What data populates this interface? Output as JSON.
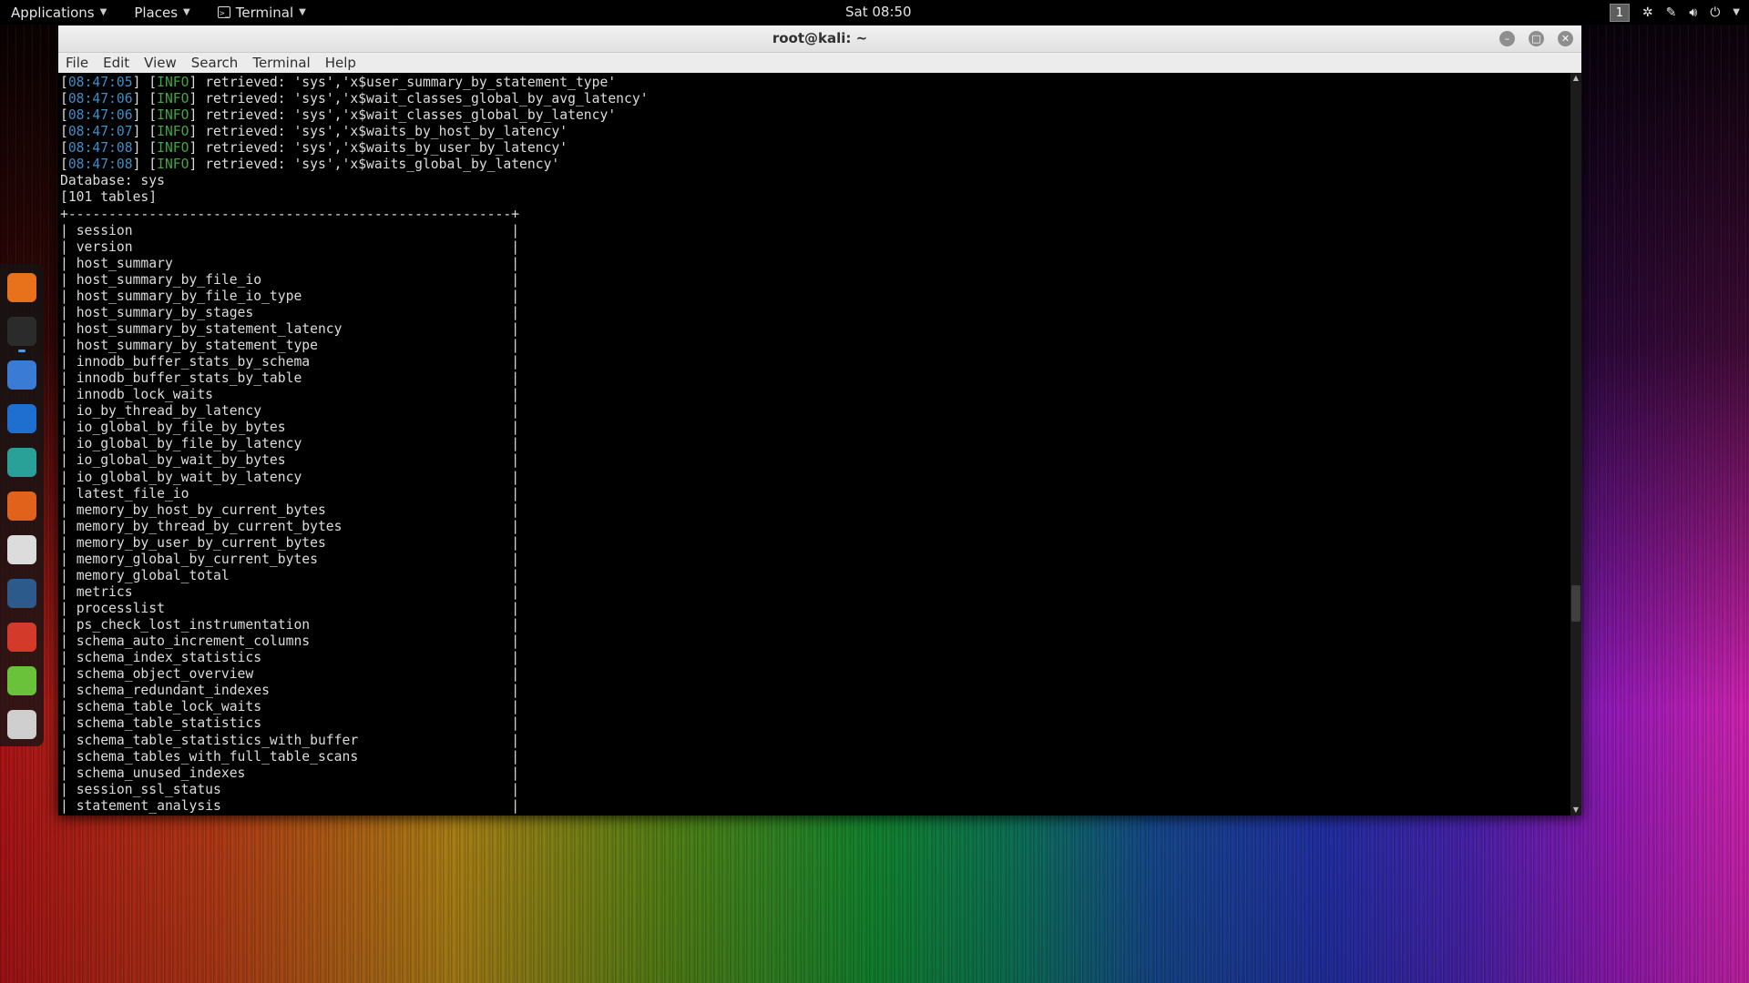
{
  "top_panel": {
    "applications_label": "Applications",
    "places_label": "Places",
    "terminal_label": "Terminal",
    "clock": "Sat 08:50",
    "workspace_number": "1"
  },
  "window": {
    "title": "root@kali: ~",
    "menu": [
      "File",
      "Edit",
      "View",
      "Search",
      "Terminal",
      "Help"
    ]
  },
  "terminal": {
    "log_lines": [
      {
        "time": "08:47:05",
        "level": "INFO",
        "message": "retrieved: 'sys','x$user_summary_by_statement_type'"
      },
      {
        "time": "08:47:06",
        "level": "INFO",
        "message": "retrieved: 'sys','x$wait_classes_global_by_avg_latency'"
      },
      {
        "time": "08:47:06",
        "level": "INFO",
        "message": "retrieved: 'sys','x$wait_classes_global_by_latency'"
      },
      {
        "time": "08:47:07",
        "level": "INFO",
        "message": "retrieved: 'sys','x$waits_by_host_by_latency'"
      },
      {
        "time": "08:47:08",
        "level": "INFO",
        "message": "retrieved: 'sys','x$waits_by_user_by_latency'"
      },
      {
        "time": "08:47:08",
        "level": "INFO",
        "message": "retrieved: 'sys','x$waits_global_by_latency'"
      }
    ],
    "database_line": "Database: sys",
    "count_line": "[101 tables]",
    "tables": [
      "session",
      "version",
      "host_summary",
      "host_summary_by_file_io",
      "host_summary_by_file_io_type",
      "host_summary_by_stages",
      "host_summary_by_statement_latency",
      "host_summary_by_statement_type",
      "innodb_buffer_stats_by_schema",
      "innodb_buffer_stats_by_table",
      "innodb_lock_waits",
      "io_by_thread_by_latency",
      "io_global_by_file_by_bytes",
      "io_global_by_file_by_latency",
      "io_global_by_wait_by_bytes",
      "io_global_by_wait_by_latency",
      "latest_file_io",
      "memory_by_host_by_current_bytes",
      "memory_by_thread_by_current_bytes",
      "memory_by_user_by_current_bytes",
      "memory_global_by_current_bytes",
      "memory_global_total",
      "metrics",
      "processlist",
      "ps_check_lost_instrumentation",
      "schema_auto_increment_columns",
      "schema_index_statistics",
      "schema_object_overview",
      "schema_redundant_indexes",
      "schema_table_lock_waits",
      "schema_table_statistics",
      "schema_table_statistics_with_buffer",
      "schema_tables_with_full_table_scans",
      "schema_unused_indexes",
      "session_ssl_status",
      "statement_analysis"
    ]
  },
  "dock": {
    "apps": [
      {
        "icon": "firefox-icon",
        "color": "#e8721c",
        "active": false
      },
      {
        "icon": "terminal-icon",
        "color": "#2b2b2b",
        "active": true
      },
      {
        "icon": "files-icon",
        "color": "#3a7bd5",
        "active": false
      },
      {
        "icon": "metasploit-icon",
        "color": "#1f6fd0",
        "active": false
      },
      {
        "icon": "armitage-icon",
        "color": "#2aa198",
        "active": false
      },
      {
        "icon": "burpsuite-icon",
        "color": "#e0621b",
        "active": false
      },
      {
        "icon": "maltego-icon",
        "color": "#dcdcdc",
        "active": false
      },
      {
        "icon": "beef-icon",
        "color": "#2c5a8a",
        "active": false
      },
      {
        "icon": "faraday-icon",
        "color": "#d43a2a",
        "active": false
      },
      {
        "icon": "notes-icon",
        "color": "#6ac23a",
        "active": false
      },
      {
        "icon": "show-apps-icon",
        "color": "#cfcfcf",
        "active": false
      }
    ]
  },
  "colors": {
    "timestamp": "#3f8ec8",
    "level": "#3fa63f",
    "text": "#dcdcdc"
  }
}
